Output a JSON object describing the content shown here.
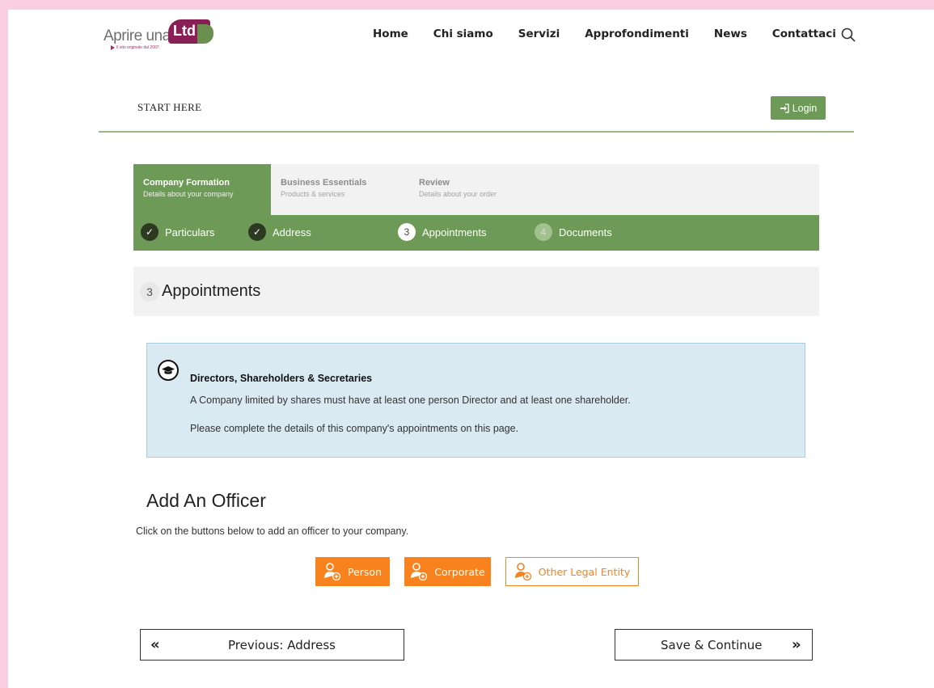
{
  "brand": {
    "text": "Aprire una",
    "badge": "Ltd",
    "tagline": "Il sito originale dal 2007"
  },
  "nav": {
    "items": [
      "Home",
      "Chi siamo",
      "Servizi",
      "Approfondimenti",
      "News",
      "Contattaci"
    ],
    "search_icon": "search-icon"
  },
  "start_here": "START HERE",
  "login": {
    "label": "Login",
    "icon": "sign-in-icon",
    "color": "#6e9a57"
  },
  "steps": [
    {
      "title": "Company Formation",
      "sub": "Details about your company",
      "active": true
    },
    {
      "title": "Business Essentials",
      "sub": "Products & services",
      "active": false
    },
    {
      "title": "Review",
      "sub": "Details about your order",
      "active": false
    }
  ],
  "substeps": [
    {
      "label": "Particulars",
      "state": "done",
      "mark": "✓"
    },
    {
      "label": "Address",
      "state": "done",
      "mark": "✓"
    },
    {
      "label": "Appointments",
      "state": "current",
      "mark": "3"
    },
    {
      "label": "Documents",
      "state": "todo",
      "mark": "4"
    }
  ],
  "section": {
    "number": "3",
    "title": "Appointments"
  },
  "info": {
    "icon": "graduation-cap-icon",
    "heading": "Directors, Shareholders & Secretaries",
    "p1": "A Company limited by shares must have at least one person Director and at least one shareholder.",
    "p2": "Please complete the details of this company's appointments on this page."
  },
  "officer": {
    "title": "Add An Officer",
    "subtitle": "Click on the buttons below to add an officer to your company.",
    "buttons": [
      "Person",
      "Corporate",
      "Other Legal Entity"
    ],
    "accent": "#f7821e"
  },
  "footer_nav": {
    "previous": "Previous: Address",
    "next": "Save & Continue",
    "prev_arrow": "«",
    "next_arrow": "»"
  }
}
